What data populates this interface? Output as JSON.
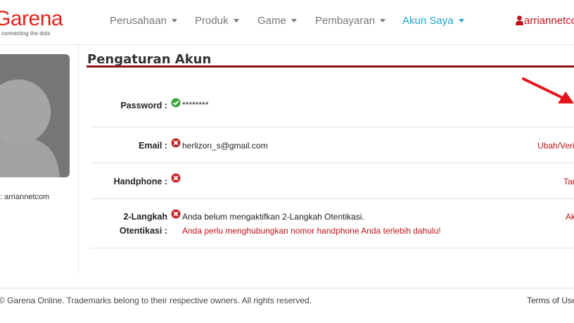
{
  "header": {
    "logo_text": "Garena",
    "logo_tagline": "connecting the dots",
    "nav": [
      {
        "label": "Perusahaan"
      },
      {
        "label": "Produk"
      },
      {
        "label": "Game"
      },
      {
        "label": "Pembayaran"
      },
      {
        "label": "Akun Saya"
      }
    ],
    "username": "arriannetcom",
    "active_color": "#1fa3d0",
    "brand_color": "#e2231a"
  },
  "sidebar": {
    "username_line": ": arriannetcom",
    "avatar_icon": "default-avatar-icon"
  },
  "main": {
    "title": "Pengaturan Akun",
    "rows": {
      "password": {
        "label": "Password :",
        "status": "check-icon",
        "value": "********"
      },
      "email": {
        "label": "Email :",
        "status": "cross-icon",
        "value": "herlizon_s@gmail.com",
        "action": "Ubah/Verifikasi"
      },
      "phone": {
        "label": "Handphone :",
        "status": "cross-icon",
        "action": "Tambah"
      },
      "twostep": {
        "label_line1": "2-Langkah",
        "label_line2": "Otentikasi :",
        "status": "cross-icon",
        "value": "Anda belum mengaktifkan 2-Langkah Otentikasi.",
        "warning": "Anda perlu menghubungkan nomor handphone Anda terlebih dahulu!",
        "action": "Aktifkan"
      }
    },
    "accent_color": "#8b1115"
  },
  "footer": {
    "copyright": "© Garena Online. Trademarks belong to their respective owners. All rights reserved.",
    "terms": "Terms of Use"
  }
}
